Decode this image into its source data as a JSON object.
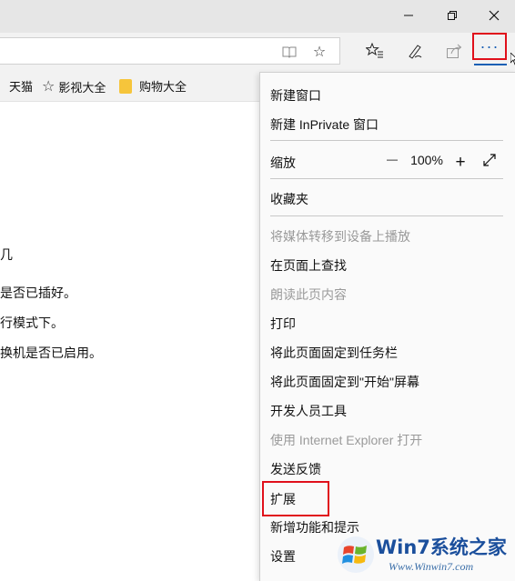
{
  "window": {
    "minimize_icon": "minimize-icon",
    "restore_icon": "restore-icon",
    "close_icon": "close-icon"
  },
  "toolbar": {
    "reading_view_icon": "reading-view-icon",
    "favorite_icon": "star-icon",
    "hub_icon": "favorites-list-icon",
    "note_icon": "web-note-pen-icon",
    "share_icon": "share-icon",
    "more_label": "···"
  },
  "favorites_bar": {
    "items": [
      {
        "label": "天猫",
        "icon": "favorite-link"
      },
      {
        "label": "影视大全",
        "icon": "star-icon"
      },
      {
        "label": "购物大全",
        "icon": "folder-icon"
      }
    ]
  },
  "page": {
    "lines": [
      "几",
      "是否已插好。",
      "行模式下。",
      "换机是否已启用。"
    ]
  },
  "menu": {
    "items": [
      {
        "label": "新建窗口",
        "disabled": false
      },
      {
        "label": "新建 InPrivate 窗口",
        "disabled": false
      },
      {
        "label": "缩放",
        "disabled": false
      },
      {
        "label": "收藏夹",
        "disabled": false
      },
      {
        "label": "将媒体转移到设备上播放",
        "disabled": true
      },
      {
        "label": "在页面上查找",
        "disabled": false
      },
      {
        "label": "朗读此页内容",
        "disabled": true
      },
      {
        "label": "打印",
        "disabled": false
      },
      {
        "label": "将此页面固定到任务栏",
        "disabled": false
      },
      {
        "label": "将此页面固定到\"开始\"屏幕",
        "disabled": false
      },
      {
        "label": "开发人员工具",
        "disabled": false
      },
      {
        "label": "使用 Internet Explorer 打开",
        "disabled": true
      },
      {
        "label": "发送反馈",
        "disabled": false
      },
      {
        "label": "扩展",
        "disabled": false
      },
      {
        "label": "新增功能和提示",
        "disabled": false
      },
      {
        "label": "设置",
        "disabled": false
      }
    ],
    "zoom": {
      "minus": "—",
      "value": "100%",
      "plus": "+",
      "fullscreen_icon": "fullscreen-icon"
    }
  },
  "watermark": {
    "logo_text": "Win7系统之家",
    "url": "Www.Winwin7.com"
  },
  "colors": {
    "highlight": "#e0101b",
    "accent": "#1a5fb4",
    "disabled_text": "#9a9a9a"
  }
}
